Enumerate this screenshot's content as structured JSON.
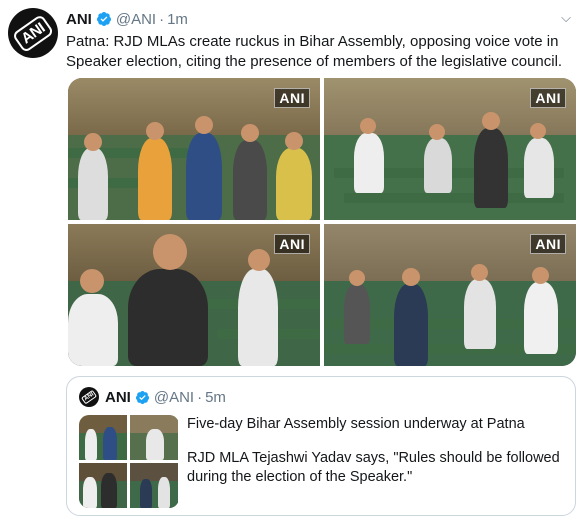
{
  "tweet": {
    "author_name": "ANI",
    "author_handle": "@ANI",
    "separator": "·",
    "time": "1m",
    "avatar_logo": "ANI",
    "text": "Patna: RJD MLAs create ruckus in Bihar Assembly, opposing voice vote in Speaker election, citing the presence of members of the legislative council.",
    "photos": [
      {
        "watermark": "ANI",
        "alt_icon": "photo-assembly-1"
      },
      {
        "watermark": "ANI",
        "alt_icon": "photo-assembly-2"
      },
      {
        "watermark": "ANI",
        "alt_icon": "photo-assembly-3"
      },
      {
        "watermark": "ANI",
        "alt_icon": "photo-assembly-4"
      }
    ],
    "menu_icon": "chevron-down-icon"
  },
  "quoted_tweet": {
    "author_name": "ANI",
    "author_handle": "@ANI",
    "separator": "·",
    "time": "5m",
    "avatar_logo": "ANI",
    "paragraph_1": "Five-day Bihar Assembly session underway at Patna",
    "paragraph_2": "RJD MLA Tejashwi Yadav says, \"Rules should be followed during the election of the Speaker.\""
  },
  "colors": {
    "verified_blue": "#1da1f2",
    "secondary_text": "#657786",
    "border": "#ccd6dd",
    "bench_green": "#3e6b44"
  }
}
